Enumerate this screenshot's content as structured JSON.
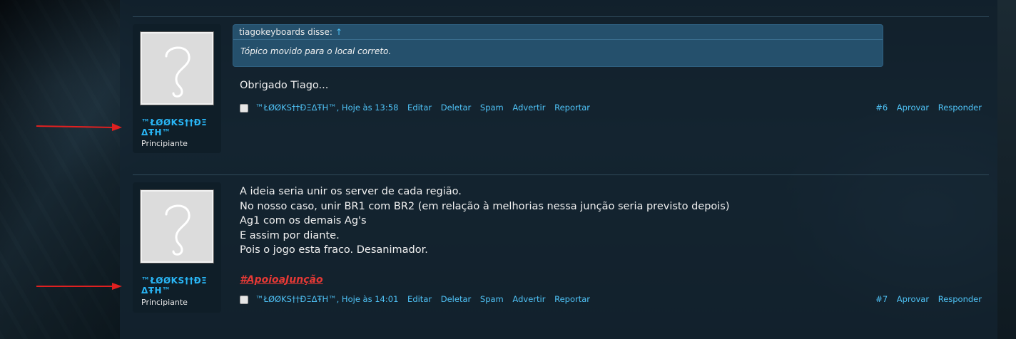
{
  "posts": [
    {
      "author": {
        "name": "™ŁØØKS††ÐΞ ΔŦH™",
        "rank": "Principiante"
      },
      "quote": {
        "header": "tiagokeyboards disse:",
        "arrow": "↑",
        "text": "Tópico movido para o local correto."
      },
      "lines": [
        "Obrigado Tiago..."
      ],
      "footer": {
        "meta": "™ŁØØKS††ÐΞΔŦH™, Hoje às 13:58",
        "edit": "Editar",
        "delete": "Deletar",
        "spam": "Spam",
        "warn": "Advertir",
        "report": "Reportar",
        "number": "#6",
        "approve": "Aprovar",
        "reply": "Responder"
      }
    },
    {
      "author": {
        "name": "™ŁØØKS††ÐΞ ΔŦH™",
        "rank": "Principiante"
      },
      "lines": [
        "A ideia seria unir os server de cada região.",
        "No nosso caso, unir BR1 com BR2 (em relação à melhorias nessa junção seria previsto depois)",
        "Ag1 com os demais Ag's",
        "E assim por diante.",
        "Pois o jogo esta fraco. Desanimador."
      ],
      "hashtag": "#ApoioaJunção",
      "footer": {
        "meta": "™ŁØØKS††ÐΞΔŦH™, Hoje às 14:01",
        "edit": "Editar",
        "delete": "Deletar",
        "spam": "Spam",
        "warn": "Advertir",
        "report": "Reportar",
        "number": "#7",
        "approve": "Aprovar",
        "reply": "Responder"
      }
    }
  ],
  "colors": {
    "link": "#4fc3f7",
    "author": "#29b6f6",
    "hashtag": "#e53935",
    "arrow": "#e02020"
  },
  "icons": {
    "avatar": "question-mark-placeholder",
    "pointer": "red-arrow"
  }
}
